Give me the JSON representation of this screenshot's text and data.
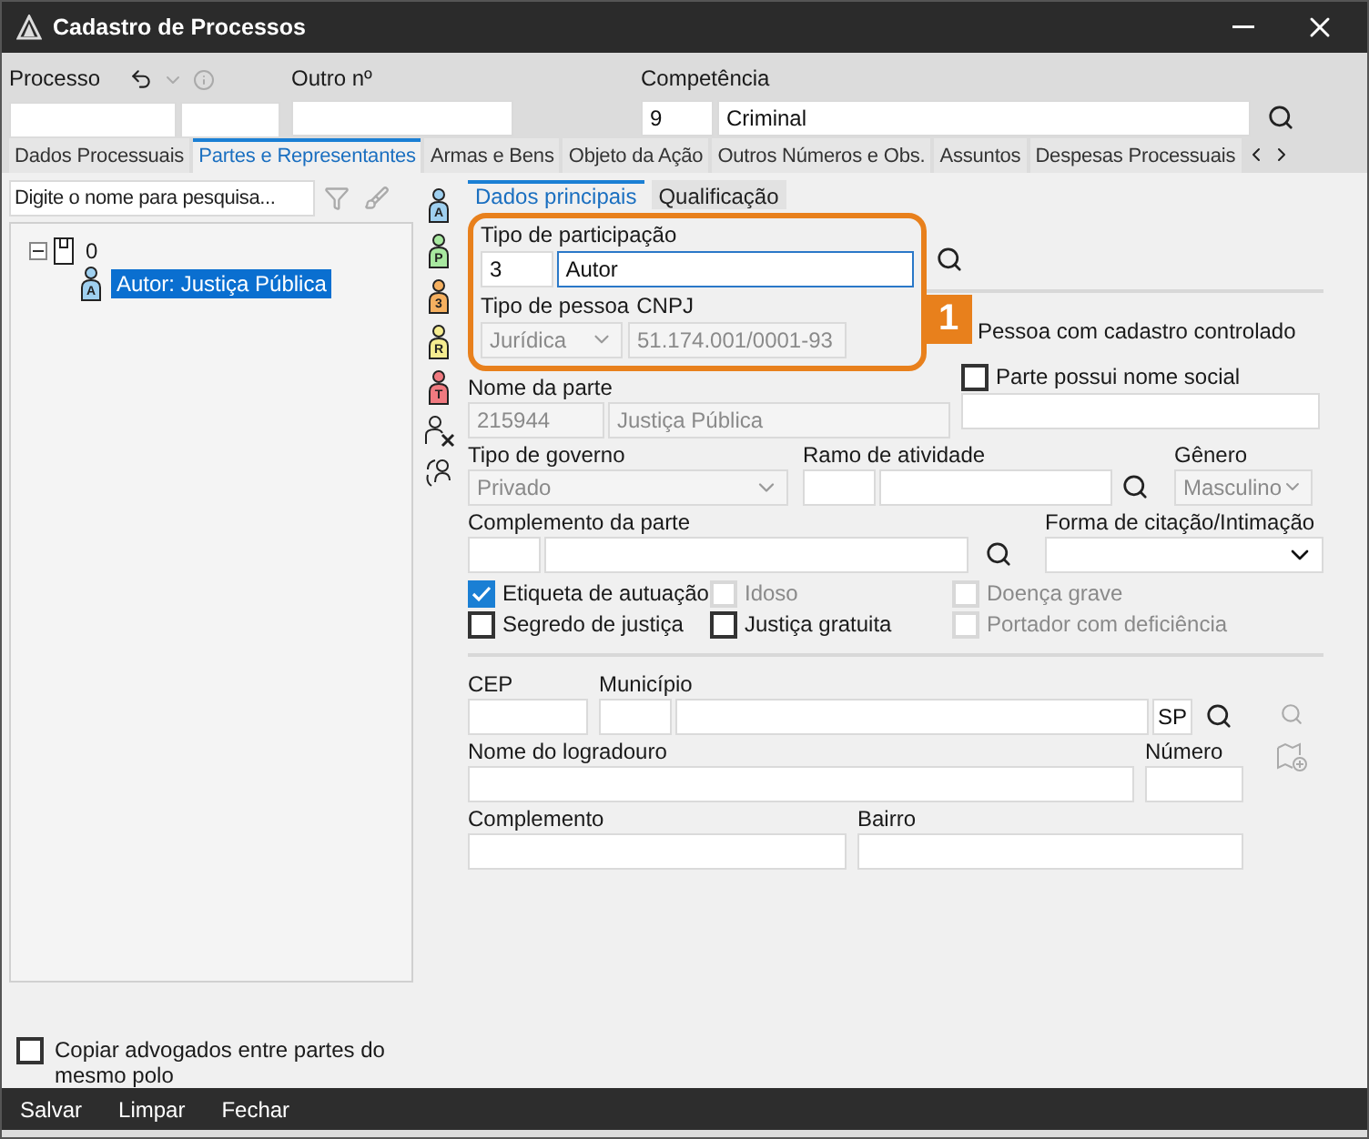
{
  "window": {
    "title": "Cadastro de Processos"
  },
  "header": {
    "processo_label": "Processo",
    "outro_label": "Outro nº",
    "competencia_label": "Competência",
    "competencia_code": "9",
    "competencia_value": "Criminal"
  },
  "tabs": [
    {
      "label": "Dados Processuais",
      "selected": false
    },
    {
      "label": "Partes e Representantes",
      "selected": true
    },
    {
      "label": "Armas e Bens",
      "selected": false
    },
    {
      "label": "Objeto da Ação",
      "selected": false
    },
    {
      "label": "Outros Números e Obs.",
      "selected": false
    },
    {
      "label": "Assuntos",
      "selected": false
    },
    {
      "label": "Despesas Processuais",
      "selected": false
    }
  ],
  "left_panel": {
    "search_placeholder": "Digite o nome para pesquisa...",
    "tree": [
      {
        "label": "0",
        "expanded": true,
        "children": [
          {
            "label": "Autor: Justiça Pública",
            "badge": "A",
            "selected": true
          }
        ]
      }
    ],
    "copy_checkbox": {
      "label": "Copiar advogados entre partes do mesmo polo",
      "checked": false
    }
  },
  "party_buttons": [
    {
      "letter": "A",
      "color": "#9fd0f0"
    },
    {
      "letter": "P",
      "color": "#a8e8a0"
    },
    {
      "letter": "3",
      "color": "#f5b060"
    },
    {
      "letter": "R",
      "color": "#f5ec90"
    },
    {
      "letter": "T",
      "color": "#f07a80"
    }
  ],
  "subtabs": [
    {
      "label": "Dados principais",
      "selected": true
    },
    {
      "label": "Qualificação",
      "selected": false
    }
  ],
  "participacao": {
    "label": "Tipo de participação",
    "code": "3",
    "value": "Autor"
  },
  "pessoa": {
    "label": "Tipo de pessoa",
    "value": "Jurídica",
    "cnpj_label": "CNPJ",
    "cnpj": "51.174.001/0001-93"
  },
  "callout": "1",
  "controlado_label": "Pessoa com cadastro controlado",
  "nome_parte": {
    "label": "Nome da parte",
    "code": "215944",
    "value": "Justiça Pública"
  },
  "nome_social": {
    "label": "Parte possui nome social",
    "checked": false
  },
  "tipo_governo": {
    "label": "Tipo de governo",
    "value": "Privado"
  },
  "ramo_label": "Ramo de atividade",
  "genero": {
    "label": "Gênero",
    "value": "Masculino"
  },
  "complemento_parte_label": "Complemento da parte",
  "forma_citacao_label": "Forma de citação/Intimação",
  "flags": [
    {
      "label": "Etiqueta de autuação",
      "checked": true,
      "disabled": false
    },
    {
      "label": "Idoso",
      "checked": false,
      "disabled": true
    },
    {
      "label": "Doença grave",
      "checked": false,
      "disabled": true
    },
    {
      "label": "Segredo de justiça",
      "checked": false,
      "disabled": false
    },
    {
      "label": "Justiça gratuita",
      "checked": false,
      "disabled": false
    },
    {
      "label": "Portador com deficiência",
      "checked": false,
      "disabled": true
    }
  ],
  "address": {
    "cep_label": "CEP",
    "municipio_label": "Município",
    "uf": "SP",
    "logradouro_label": "Nome do logradouro",
    "numero_label": "Número",
    "complemento_label": "Complemento",
    "bairro_label": "Bairro"
  },
  "footer_buttons": [
    "Salvar",
    "Limpar",
    "Fechar"
  ]
}
